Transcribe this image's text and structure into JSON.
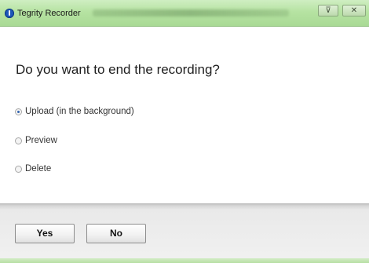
{
  "window": {
    "title": "Tegrity Recorder",
    "pin_icon": "pin-icon",
    "close_icon": "close-icon"
  },
  "dialog": {
    "question": "Do you want to end the recording?",
    "options": [
      {
        "label": "Upload (in the background)",
        "selected": true
      },
      {
        "label": "Preview",
        "selected": false
      },
      {
        "label": "Delete",
        "selected": false
      }
    ]
  },
  "buttons": {
    "yes": "Yes",
    "no": "No"
  },
  "colors": {
    "titlebar": "#b6e3a2",
    "app_icon": "#1d57b8"
  }
}
